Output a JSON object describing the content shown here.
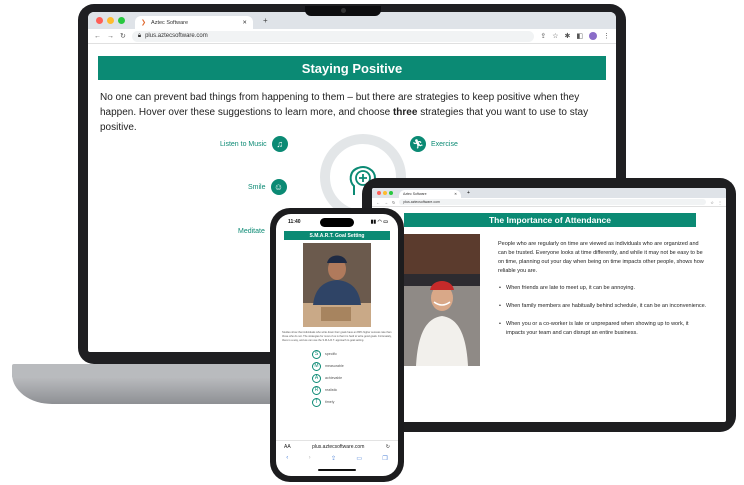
{
  "laptop": {
    "browser": {
      "tab_title": "Aztec Software",
      "url": "plus.aztecsoftware.com"
    },
    "slide": {
      "title": "Staying Positive",
      "intro_before": "No one can prevent bad things from happening to them – but there are strategies to keep positive when they happen. Hover over these suggestions to learn more, and choose ",
      "intro_bold": "three",
      "intro_after": " strategies that you want to use to stay positive.",
      "strategies": [
        "Listen to Music",
        "Exercise",
        "Smile",
        "Meditate"
      ]
    }
  },
  "tablet": {
    "browser": {
      "tab_title": "Aztec Software",
      "url": "plus.aztecsoftware.com"
    },
    "slide": {
      "title": "The Importance of Attendance",
      "paragraph": "People who are regularly on time are viewed as individuals who are organized and can be trusted. Everyone looks at time differently, and while it may not be easy to be on time, planning out your day when being on time impacts other people, shows how reliable you are.",
      "bullets": [
        "When friends are late to meet up, it can be annoying.",
        "When family members are habitually behind schedule, it can be an inconvenience.",
        "When you or a co-worker is late or unprepared when showing up to work, it impacts your team and can disrupt an entire business."
      ]
    }
  },
  "phone": {
    "status_time": "11:40",
    "slide": {
      "title": "S.M.A.R.T. Goal Setting",
      "caption": "Studies show that individuals who write down their goals have an 80% higher success rate than those who do not. The strategies for most of us is that it is hard to write good goals. Fortunately, there is a way, and we can use the S.M.A.R.T. approach to goal setting.",
      "items": [
        {
          "letter": "S",
          "word": "specific"
        },
        {
          "letter": "M",
          "word": "measurable"
        },
        {
          "letter": "A",
          "word": "achievable"
        },
        {
          "letter": "R",
          "word": "realistic"
        },
        {
          "letter": "T",
          "word": "timely"
        }
      ]
    },
    "browser": {
      "text_size": "AA",
      "url": "plus.aztecsoftware.com"
    }
  },
  "colors": {
    "accent": "#0b8a74"
  }
}
